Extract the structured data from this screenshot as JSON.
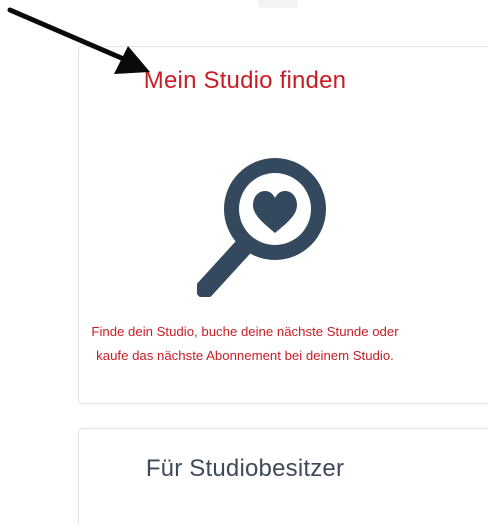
{
  "studio_card": {
    "title": "Mein Studio finden",
    "description_line1": "Finde dein Studio, buche deine nächste Stunde oder",
    "description_line2": "kaufe das nächste Abonnement bei deinem Studio.",
    "icon": "magnifier-heart-icon"
  },
  "owner_card": {
    "title": "Für Studiobesitzer"
  },
  "annotation": {
    "icon": "arrow-annotation-icon"
  },
  "colors": {
    "accent_red": "#c81d25",
    "icon_navy": "#34495e",
    "title_gray": "#3e4a59",
    "card_border": "#e3e6e9"
  }
}
